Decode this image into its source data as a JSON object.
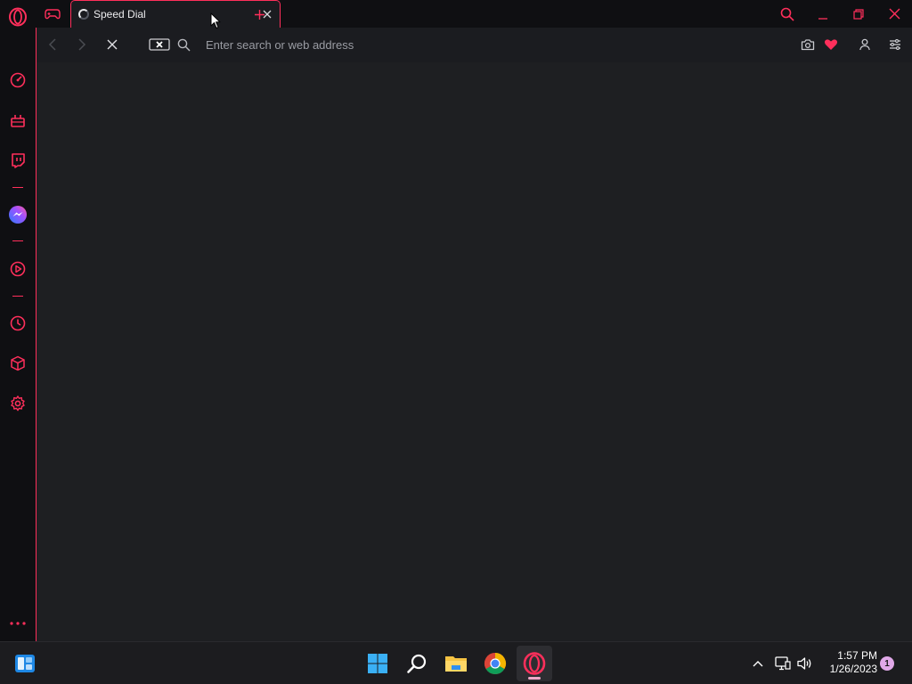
{
  "theme": {
    "accent": "#ff2f5b",
    "content_bg": "#1e1f22",
    "chrome_bg": "#0f0f12",
    "taskbar_bg": "#1c1c1f"
  },
  "sidebar": {
    "items": [
      {
        "icon": "opera-logo-icon"
      },
      {
        "icon": "speed-dial-gauge-icon"
      },
      {
        "icon": "game-console-icon"
      },
      {
        "icon": "twitch-icon"
      },
      {
        "icon": "messenger-icon"
      },
      {
        "icon": "player-icon"
      },
      {
        "icon": "history-clock-icon"
      },
      {
        "icon": "extensions-cube-icon"
      },
      {
        "icon": "settings-gear-icon"
      },
      {
        "icon": "more-dots-icon"
      }
    ]
  },
  "tabs": [
    {
      "title": "Speed Dial",
      "loading": true,
      "active": true
    }
  ],
  "address_bar": {
    "placeholder": "Enter search or web address",
    "value": ""
  },
  "taskbar": {
    "apps": [
      "windows-start-icon",
      "search-icon",
      "file-explorer-icon",
      "chrome-icon",
      "opera-gx-icon"
    ],
    "clock": {
      "time": "1:57 PM",
      "date": "1/26/2023"
    },
    "notification_count": "1"
  }
}
